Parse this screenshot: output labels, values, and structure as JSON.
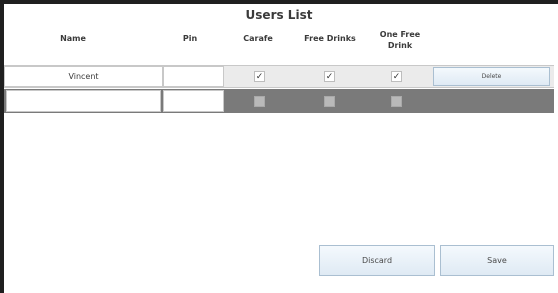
{
  "title": "Users List",
  "columns": {
    "name": "Name",
    "pin": "Pin",
    "carafe": "Carafe",
    "free_drinks": "Free Drinks",
    "one_free_drink_line1": "One Free",
    "one_free_drink_line2": "Drink"
  },
  "rows": [
    {
      "name": "Vincent",
      "pin": "",
      "carafe": "✓",
      "free_drinks": "✓",
      "one_free_drink": "✓",
      "delete_label": "Delete"
    },
    {
      "name": "",
      "pin": ""
    }
  ],
  "buttons": {
    "discard": "Discard",
    "save": "Save"
  }
}
